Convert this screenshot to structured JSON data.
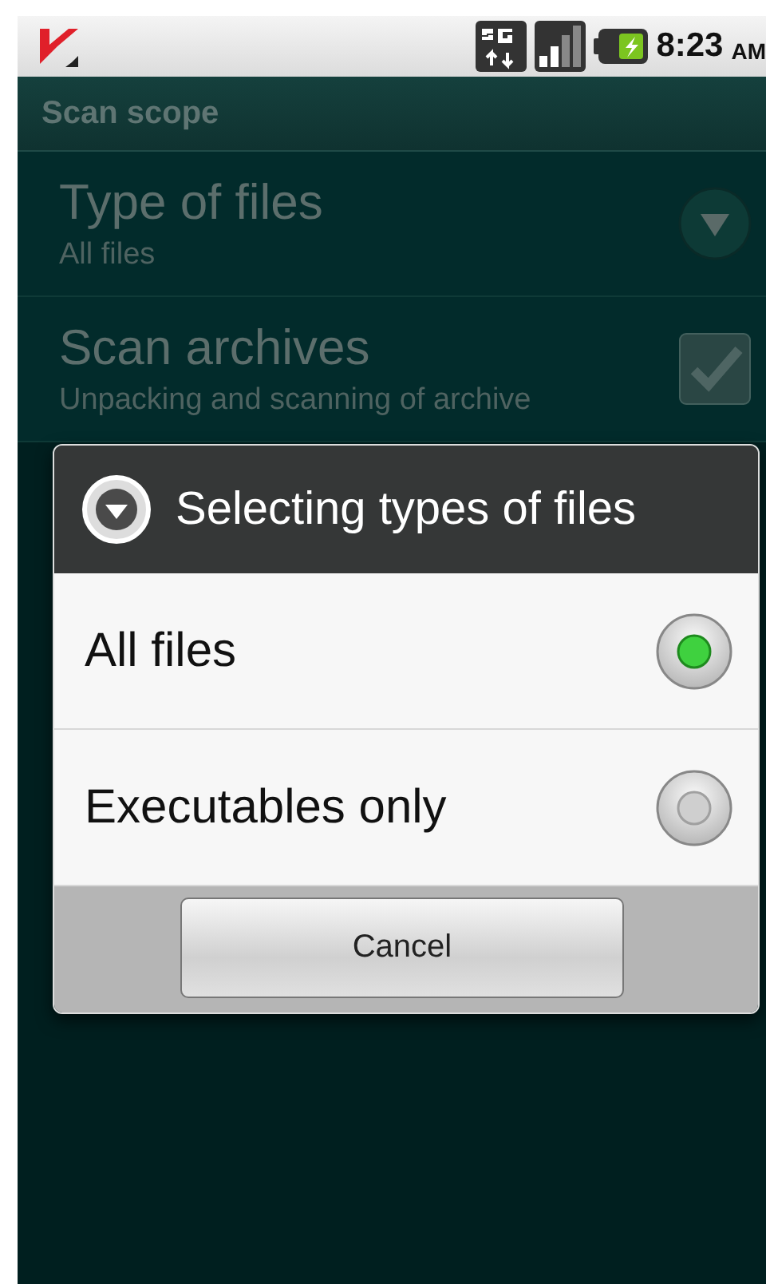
{
  "status_bar": {
    "time": "8:23",
    "period": "AM"
  },
  "header": {
    "title": "Scan scope"
  },
  "settings": [
    {
      "kind": "dropdown",
      "title": "Type of files",
      "summary": "All files"
    },
    {
      "kind": "checkbox",
      "title": "Scan archives",
      "summary": "Unpacking and scanning of archive",
      "checked": true
    }
  ],
  "dialog": {
    "title": "Selecting types of files",
    "options": [
      {
        "label": "All files",
        "selected": true
      },
      {
        "label": "Executables only",
        "selected": false
      }
    ],
    "buttons": [
      "Cancel"
    ]
  }
}
